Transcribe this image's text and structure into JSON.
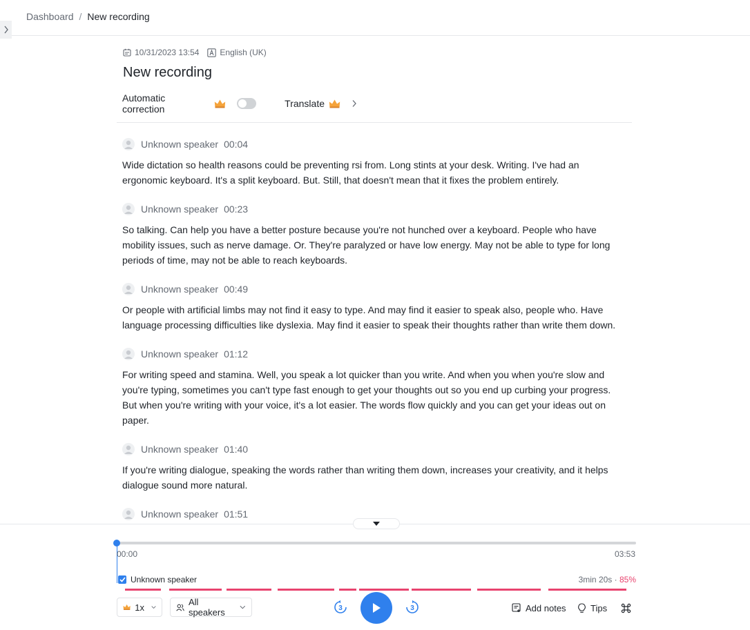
{
  "breadcrumb": {
    "parent": "Dashboard",
    "separator": "/",
    "current": "New recording"
  },
  "meta": {
    "datetime": "10/31/2023 13:54",
    "language": "English (UK)"
  },
  "title": "New recording",
  "options": {
    "auto_correction_label": "Automatic correction",
    "auto_correction_enabled": false,
    "translate_label": "Translate"
  },
  "segments": [
    {
      "speaker": "Unknown speaker",
      "time": "00:04",
      "text": "Wide dictation so health reasons could be preventing rsi from. Long stints at your desk. Writing. I've had an ergonomic keyboard. It's a split keyboard. But. Still, that doesn't mean that it fixes the problem entirely."
    },
    {
      "speaker": "Unknown speaker",
      "time": "00:23",
      "text": "So talking. Can help you have a better posture because you're not hunched over a keyboard. People who have mobility issues, such as nerve damage. Or. They're paralyzed or have low energy. May not be able to type for long periods of time, may not be able to reach keyboards."
    },
    {
      "speaker": "Unknown speaker",
      "time": "00:49",
      "text": "Or people with artificial limbs may not find it easy to type. And may find it easier to speak also, people who. Have language processing difficulties like dyslexia. May find it easier to speak their thoughts rather than write them down."
    },
    {
      "speaker": "Unknown speaker",
      "time": "01:12",
      "text": "For writing speed and stamina. Well, you speak a lot quicker than you write. And when you when you're slow and you're typing, sometimes you can't type fast enough to get your thoughts out so you end up curbing your progress. But when you're writing with your voice, it's a lot easier. The words flow quickly and you can get your ideas out on paper."
    },
    {
      "speaker": "Unknown speaker",
      "time": "01:40",
      "text": "If you're writing dialogue, speaking the words rather than writing them down, increases your creativity, and it helps dialogue sound more natural."
    },
    {
      "speaker": "Unknown speaker",
      "time": "01:51",
      "text": ""
    }
  ],
  "player": {
    "current_time": "00:00",
    "total_time": "03:53",
    "progress_fraction": 0,
    "speaker_label": "Unknown speaker",
    "speaker_duration": "3min 20s",
    "speaker_separator": " · ",
    "speaker_percent": "85%",
    "speed_label": "1x",
    "speakers_filter_label": "All speakers",
    "skip_back_seconds": "3",
    "skip_forward_seconds": "3",
    "add_notes_label": "Add notes",
    "tips_label": "Tips"
  },
  "colors": {
    "accent": "#2f80ed",
    "speech_activity": "#e8436e",
    "premium_crown": "#f5a33a"
  },
  "icons": {
    "sidebar_toggle": "chevron-right-icon",
    "date": "calendar-icon",
    "language": "language-icon",
    "premium": "crown-icon",
    "speaker": "user-avatar-icon",
    "collapse": "caret-down-icon",
    "play": "play-icon",
    "skip_back": "rewind-3-icon",
    "skip_forward": "forward-3-icon",
    "notes": "notes-icon",
    "tips": "lightbulb-icon",
    "shortcuts": "command-key-icon"
  }
}
